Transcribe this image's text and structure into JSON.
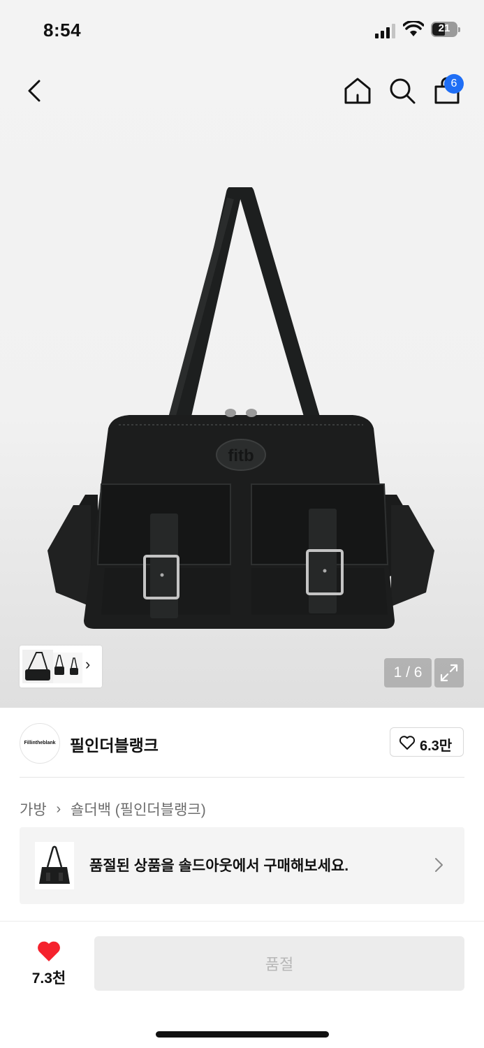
{
  "status": {
    "time": "8:54",
    "battery": "21"
  },
  "nav": {
    "back_icon": "chevron-left-icon",
    "home_icon": "home-icon",
    "search_icon": "search-icon",
    "cart_icon": "shopping-bag-icon",
    "cart_count": "6"
  },
  "gallery": {
    "counter": "1 / 6",
    "thumb_arrow": "›",
    "current": 1,
    "total": 6
  },
  "brand": {
    "logo_text": "Fillintheblank",
    "name": "필인더블랭크",
    "like_count": "6.3만"
  },
  "breadcrumb": {
    "category": "가방",
    "separator": "›",
    "subcategory": "숄더백 (필인더블랭크)"
  },
  "soldout_card": {
    "text": "품절된 상품을 솔드아웃에서 구매해보세요."
  },
  "bottom_bar": {
    "wish_count": "7.3천",
    "buy_label": "품절"
  },
  "colors": {
    "accent_blue": "#1f6ef5",
    "heart_red": "#f5222d",
    "disabled_bg": "#ececec",
    "disabled_text": "#b7b7b7"
  }
}
